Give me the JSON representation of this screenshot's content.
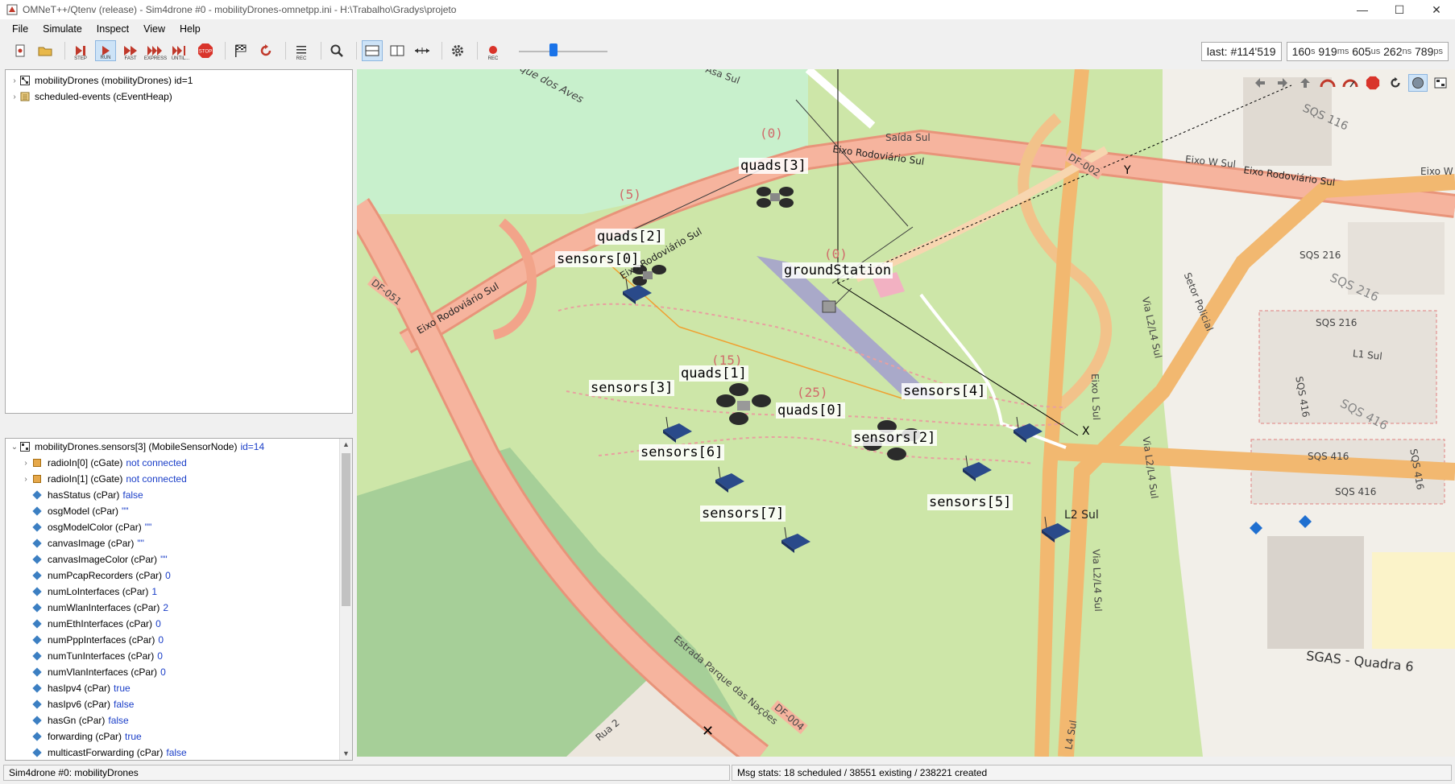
{
  "window": {
    "title": "OMNeT++/Qtenv (release) - Sim4drone #0 - mobilityDrones-omnetpp.ini - H:\\Trabalho\\Gradys\\projeto",
    "controls": [
      "—",
      "☐",
      "✕"
    ]
  },
  "menu": [
    "File",
    "Simulate",
    "Inspect",
    "View",
    "Help"
  ],
  "toolbar": {
    "step": "STEP",
    "run": "RUN",
    "fast": "FAST",
    "express": "EXPRESS",
    "until": "UNTIL...",
    "stop": "STOP",
    "rec": "REC",
    "rec2": "REC"
  },
  "counters": {
    "event": "last: #114'519",
    "t_s": "160",
    "t_ms": "919",
    "t_us": "605",
    "t_ns": "262",
    "t_ps": "789",
    "u_s": "s",
    "u_ms": "ms",
    "u_us": "us",
    "u_ns": "ns",
    "u_ps": "ps"
  },
  "objtree": [
    {
      "label": "mobilityDrones (mobilityDrones) id=1"
    },
    {
      "label": "scheduled-events (cEventHeap)"
    }
  ],
  "props": {
    "header": "mobilityDrones.sensors[3] (MobileSensorNode)",
    "header_id": "id=14",
    "rows": [
      {
        "kind": "gate",
        "name": "radioIn[0] (cGate)",
        "value": "not connected"
      },
      {
        "kind": "gate",
        "name": "radioIn[1] (cGate)",
        "value": "not connected"
      },
      {
        "kind": "par",
        "name": "hasStatus (cPar)",
        "value": "false"
      },
      {
        "kind": "par",
        "name": "osgModel (cPar)",
        "value": "\"\""
      },
      {
        "kind": "par",
        "name": "osgModelColor (cPar)",
        "value": "\"\""
      },
      {
        "kind": "par",
        "name": "canvasImage (cPar)",
        "value": "\"\""
      },
      {
        "kind": "par",
        "name": "canvasImageColor (cPar)",
        "value": "\"\""
      },
      {
        "kind": "par",
        "name": "numPcapRecorders (cPar)",
        "value": "0"
      },
      {
        "kind": "par",
        "name": "numLoInterfaces (cPar)",
        "value": "1"
      },
      {
        "kind": "par",
        "name": "numWlanInterfaces (cPar)",
        "value": "2"
      },
      {
        "kind": "par",
        "name": "numEthInterfaces (cPar)",
        "value": "0"
      },
      {
        "kind": "par",
        "name": "numPppInterfaces (cPar)",
        "value": "0"
      },
      {
        "kind": "par",
        "name": "numTunInterfaces (cPar)",
        "value": "0"
      },
      {
        "kind": "par",
        "name": "numVlanInterfaces (cPar)",
        "value": "0"
      },
      {
        "kind": "par",
        "name": "hasIpv4 (cPar)",
        "value": "true"
      },
      {
        "kind": "par",
        "name": "hasIpv6 (cPar)",
        "value": "false"
      },
      {
        "kind": "par",
        "name": "hasGn (cPar)",
        "value": "false"
      },
      {
        "kind": "par",
        "name": "forwarding (cPar)",
        "value": "true"
      },
      {
        "kind": "par",
        "name": "multicastForwarding (cPar)",
        "value": "false"
      }
    ]
  },
  "status": {
    "left": "Sim4drone #0: mobilityDrones",
    "right": "Msg stats: 18 scheduled / 38551 existing / 238221 created"
  },
  "map": {
    "nodes": [
      {
        "label": "quads[3]",
        "count": "(0)"
      },
      {
        "label": "quads[2]",
        "count": "(5)"
      },
      {
        "label": "sensors[0]"
      },
      {
        "label": "groundStation",
        "count": "(0)"
      },
      {
        "label": "quads[1]",
        "count": "(15)"
      },
      {
        "label": "sensors[3]"
      },
      {
        "label": "quads[0]",
        "count": "(25)"
      },
      {
        "label": "sensors[4]"
      },
      {
        "label": "sensors[2]"
      },
      {
        "label": "sensors[6]"
      },
      {
        "label": "sensors[7]"
      },
      {
        "label": "sensors[5]"
      }
    ],
    "street_labels": [
      "Parque dos Aves",
      "Eixo Rodoviário Sul",
      "Eixo Rodoviário Sul",
      "Eixo Rodoviário Sul",
      "Eixo Rodoviário Sul",
      "DF-051",
      "DF-002",
      "DF-004",
      "Saída Sul",
      "Eixo W Sul",
      "Eixo W",
      "SQS 116",
      "SQS 216",
      "SQS 216",
      "SQS 216",
      "L1 Sul",
      "SQS 416",
      "SQS 416",
      "SQS 416",
      "SQS 416",
      "SQS 416",
      "L2 Sul",
      "SGAS - Quadra 6",
      "Via L2/L4 Sul",
      "Via L2/L4 Sul",
      "Via L2/L4 Sul",
      "Eixo L Sul",
      "Setor Policial",
      "Estrada Parque das Nações",
      "Rua 2",
      "Asa Sul",
      "L4 Sul",
      "X",
      "Y"
    ]
  }
}
